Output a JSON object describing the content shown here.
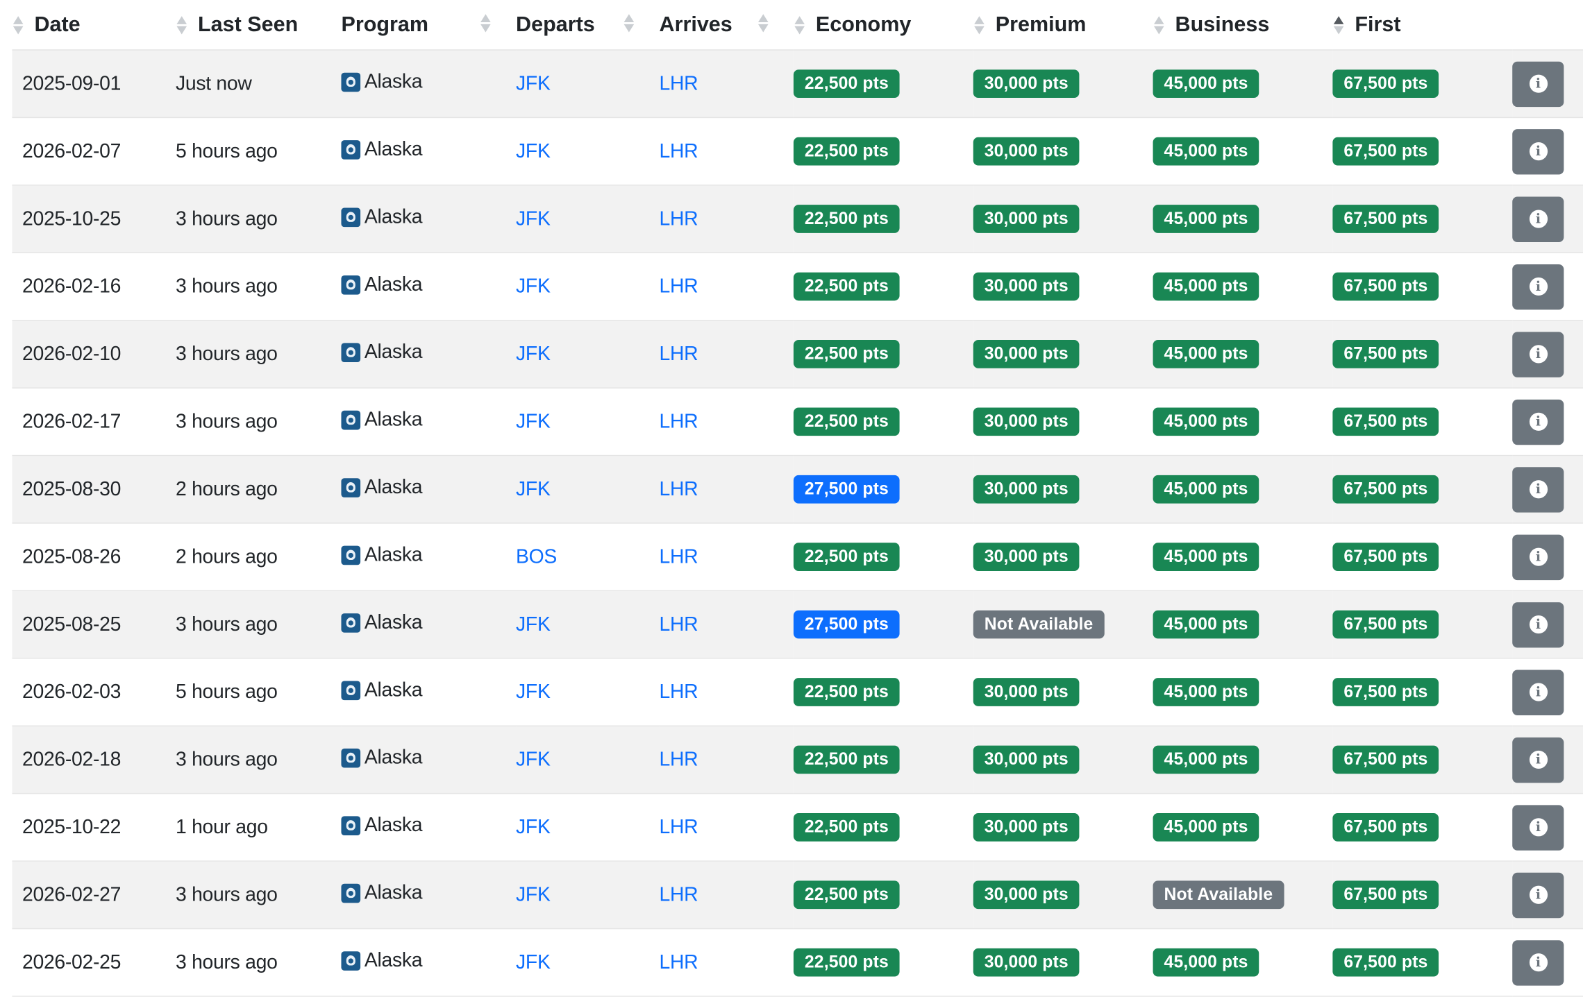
{
  "columns": {
    "date": "Date",
    "last_seen": "Last Seen",
    "program": "Program",
    "departs": "Departs",
    "arrives": "Arrives",
    "economy": "Economy",
    "premium": "Premium",
    "business": "Business",
    "first": "First"
  },
  "sort": {
    "column": "first",
    "direction": "ascending"
  },
  "colors": {
    "available": "#198754",
    "highlight": "#0d6efd",
    "unavailable": "#6c757d",
    "link": "#0d6efd"
  },
  "icons": {
    "program_logo": "alaska-airlines-logo-icon",
    "row_action": "info-icon"
  },
  "rows": [
    {
      "date": "2025-09-01",
      "last_seen": "Just now",
      "program": "Alaska",
      "departs": "JFK",
      "arrives": "LHR",
      "economy": {
        "text": "22,500 pts",
        "status": "green"
      },
      "premium": {
        "text": "30,000 pts",
        "status": "green"
      },
      "business": {
        "text": "45,000 pts",
        "status": "green"
      },
      "first": {
        "text": "67,500 pts",
        "status": "green"
      }
    },
    {
      "date": "2026-02-07",
      "last_seen": "5 hours ago",
      "program": "Alaska",
      "departs": "JFK",
      "arrives": "LHR",
      "economy": {
        "text": "22,500 pts",
        "status": "green"
      },
      "premium": {
        "text": "30,000 pts",
        "status": "green"
      },
      "business": {
        "text": "45,000 pts",
        "status": "green"
      },
      "first": {
        "text": "67,500 pts",
        "status": "green"
      }
    },
    {
      "date": "2025-10-25",
      "last_seen": "3 hours ago",
      "program": "Alaska",
      "departs": "JFK",
      "arrives": "LHR",
      "economy": {
        "text": "22,500 pts",
        "status": "green"
      },
      "premium": {
        "text": "30,000 pts",
        "status": "green"
      },
      "business": {
        "text": "45,000 pts",
        "status": "green"
      },
      "first": {
        "text": "67,500 pts",
        "status": "green"
      }
    },
    {
      "date": "2026-02-16",
      "last_seen": "3 hours ago",
      "program": "Alaska",
      "departs": "JFK",
      "arrives": "LHR",
      "economy": {
        "text": "22,500 pts",
        "status": "green"
      },
      "premium": {
        "text": "30,000 pts",
        "status": "green"
      },
      "business": {
        "text": "45,000 pts",
        "status": "green"
      },
      "first": {
        "text": "67,500 pts",
        "status": "green"
      }
    },
    {
      "date": "2026-02-10",
      "last_seen": "3 hours ago",
      "program": "Alaska",
      "departs": "JFK",
      "arrives": "LHR",
      "economy": {
        "text": "22,500 pts",
        "status": "green"
      },
      "premium": {
        "text": "30,000 pts",
        "status": "green"
      },
      "business": {
        "text": "45,000 pts",
        "status": "green"
      },
      "first": {
        "text": "67,500 pts",
        "status": "green"
      }
    },
    {
      "date": "2026-02-17",
      "last_seen": "3 hours ago",
      "program": "Alaska",
      "departs": "JFK",
      "arrives": "LHR",
      "economy": {
        "text": "22,500 pts",
        "status": "green"
      },
      "premium": {
        "text": "30,000 pts",
        "status": "green"
      },
      "business": {
        "text": "45,000 pts",
        "status": "green"
      },
      "first": {
        "text": "67,500 pts",
        "status": "green"
      }
    },
    {
      "date": "2025-08-30",
      "last_seen": "2 hours ago",
      "program": "Alaska",
      "departs": "JFK",
      "arrives": "LHR",
      "economy": {
        "text": "27,500 pts",
        "status": "blue"
      },
      "premium": {
        "text": "30,000 pts",
        "status": "green"
      },
      "business": {
        "text": "45,000 pts",
        "status": "green"
      },
      "first": {
        "text": "67,500 pts",
        "status": "green"
      }
    },
    {
      "date": "2025-08-26",
      "last_seen": "2 hours ago",
      "program": "Alaska",
      "departs": "BOS",
      "arrives": "LHR",
      "economy": {
        "text": "22,500 pts",
        "status": "green"
      },
      "premium": {
        "text": "30,000 pts",
        "status": "green"
      },
      "business": {
        "text": "45,000 pts",
        "status": "green"
      },
      "first": {
        "text": "67,500 pts",
        "status": "green"
      }
    },
    {
      "date": "2025-08-25",
      "last_seen": "3 hours ago",
      "program": "Alaska",
      "departs": "JFK",
      "arrives": "LHR",
      "economy": {
        "text": "27,500 pts",
        "status": "blue"
      },
      "premium": {
        "text": "Not Available",
        "status": "gray"
      },
      "business": {
        "text": "45,000 pts",
        "status": "green"
      },
      "first": {
        "text": "67,500 pts",
        "status": "green"
      }
    },
    {
      "date": "2026-02-03",
      "last_seen": "5 hours ago",
      "program": "Alaska",
      "departs": "JFK",
      "arrives": "LHR",
      "economy": {
        "text": "22,500 pts",
        "status": "green"
      },
      "premium": {
        "text": "30,000 pts",
        "status": "green"
      },
      "business": {
        "text": "45,000 pts",
        "status": "green"
      },
      "first": {
        "text": "67,500 pts",
        "status": "green"
      }
    },
    {
      "date": "2026-02-18",
      "last_seen": "3 hours ago",
      "program": "Alaska",
      "departs": "JFK",
      "arrives": "LHR",
      "economy": {
        "text": "22,500 pts",
        "status": "green"
      },
      "premium": {
        "text": "30,000 pts",
        "status": "green"
      },
      "business": {
        "text": "45,000 pts",
        "status": "green"
      },
      "first": {
        "text": "67,500 pts",
        "status": "green"
      }
    },
    {
      "date": "2025-10-22",
      "last_seen": "1 hour ago",
      "program": "Alaska",
      "departs": "JFK",
      "arrives": "LHR",
      "economy": {
        "text": "22,500 pts",
        "status": "green"
      },
      "premium": {
        "text": "30,000 pts",
        "status": "green"
      },
      "business": {
        "text": "45,000 pts",
        "status": "green"
      },
      "first": {
        "text": "67,500 pts",
        "status": "green"
      }
    },
    {
      "date": "2026-02-27",
      "last_seen": "3 hours ago",
      "program": "Alaska",
      "departs": "JFK",
      "arrives": "LHR",
      "economy": {
        "text": "22,500 pts",
        "status": "green"
      },
      "premium": {
        "text": "30,000 pts",
        "status": "green"
      },
      "business": {
        "text": "Not Available",
        "status": "gray"
      },
      "first": {
        "text": "67,500 pts",
        "status": "green"
      }
    },
    {
      "date": "2026-02-25",
      "last_seen": "3 hours ago",
      "program": "Alaska",
      "departs": "JFK",
      "arrives": "LHR",
      "economy": {
        "text": "22,500 pts",
        "status": "green"
      },
      "premium": {
        "text": "30,000 pts",
        "status": "green"
      },
      "business": {
        "text": "45,000 pts",
        "status": "green"
      },
      "first": {
        "text": "67,500 pts",
        "status": "green"
      }
    }
  ]
}
